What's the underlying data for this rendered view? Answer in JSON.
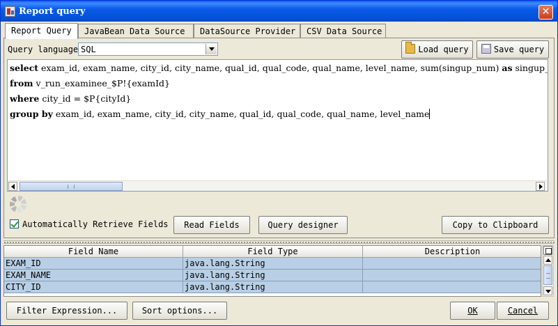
{
  "window": {
    "title": "Report query",
    "close_label": "✕"
  },
  "tabs": [
    {
      "label": "Report Query",
      "active": true
    },
    {
      "label": "JavaBean Data Source",
      "active": false
    },
    {
      "label": "DataSource Provider",
      "active": false
    },
    {
      "label": "CSV Data Source",
      "active": false
    }
  ],
  "query": {
    "language_label": "Query language",
    "language_value": "SQL",
    "load_label": "Load query",
    "save_label": "Save query",
    "lines": [
      {
        "kw": "select",
        "text": " exam_id, exam_name, city_id, city_name, qual_id, qual_code, qual_name, level_name, sum(singup_num) ",
        "kw2": "as",
        "tail": " singup_n"
      },
      {
        "kw": "from",
        "text": " v_run_examinee_$P!{examId}"
      },
      {
        "kw": "where",
        "text": " city_id = $P{cityId}"
      },
      {
        "kw": "group by",
        "text": " exam_id, exam_name, city_id, city_name, qual_id, qual_code, qual_name, level_name"
      }
    ]
  },
  "options": {
    "auto_retrieve_label": "Automatically Retrieve Fields",
    "auto_retrieve_checked": true,
    "read_fields_label": "Read Fields",
    "query_designer_label": "Query designer",
    "copy_clipboard_label": "Copy to Clipboard"
  },
  "fields_table": {
    "columns": [
      "Field Name",
      "Field Type",
      "Description"
    ],
    "rows": [
      [
        "EXAM_ID",
        "java.lang.String",
        ""
      ],
      [
        "EXAM_NAME",
        "java.lang.String",
        ""
      ],
      [
        "CITY_ID",
        "java.lang.String",
        ""
      ]
    ]
  },
  "footer": {
    "filter_label": "Filter Expression...",
    "sort_label": "Sort options...",
    "ok_label": "OK",
    "cancel_label": "Cancel"
  },
  "colors": {
    "titlebar": "#0a5ae8",
    "selected_row": "#b8cfe5",
    "window_bg": "#ece9d8"
  },
  "icons": {
    "app": "report-icon",
    "load": "folder-open-icon",
    "save": "save-disk-icon",
    "busy": "spinner-icon"
  }
}
